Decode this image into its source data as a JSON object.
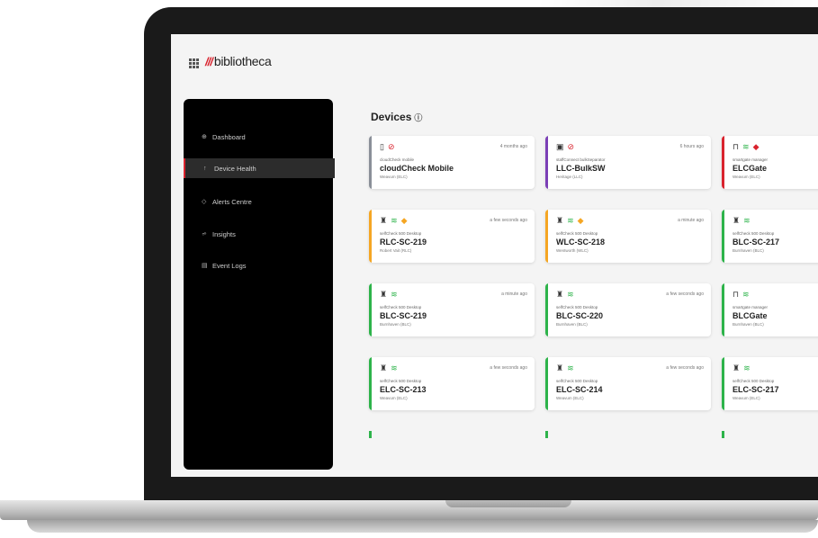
{
  "app": {
    "logo_mark": "///",
    "logo_text": "bibliotheca"
  },
  "sidebar": {
    "items": [
      {
        "label": "Dashboard",
        "icon": "dashboard-icon",
        "glyph": "⊕"
      },
      {
        "label": "Device Health",
        "icon": "heartbeat-icon",
        "glyph": "↑"
      },
      {
        "label": "Alerts Centre",
        "icon": "alert-icon",
        "glyph": "◇"
      },
      {
        "label": "Insights",
        "icon": "chart-icon",
        "glyph": "⩫"
      },
      {
        "label": "Event Logs",
        "icon": "document-icon",
        "glyph": "▤"
      }
    ]
  },
  "main": {
    "title": "Devices",
    "title_icon": "info-icon"
  },
  "colors": {
    "gray": "#8a8f98",
    "purple": "#7b3fb6",
    "red": "#d9232e",
    "orange": "#f5a623",
    "green": "#2db34a"
  },
  "cards": [
    {
      "type": "cloudCheck mobile",
      "name": "cloudCheck Mobile",
      "location": "Weavum (ELC)",
      "time": "4 months ago",
      "status_color": "#8a8f98",
      "device_icon": "phone-icon",
      "status_icons": [
        "no-signal-icon"
      ]
    },
    {
      "type": "staffConnect bulkSeparator",
      "name": "LLC-BulkSW",
      "location": "Heritage (LLC)",
      "time": "6 hours ago",
      "status_color": "#7b3fb6",
      "device_icon": "sorter-icon",
      "status_icons": [
        "no-signal-icon"
      ]
    },
    {
      "type": "smartgate manager",
      "name": "ELCGate",
      "location": "Weavum (ELC)",
      "time": "",
      "status_color": "#d9232e",
      "device_icon": "gate-icon",
      "status_icons": [
        "wifi-icon",
        "error-diamond-icon"
      ]
    },
    {
      "type": "selfCheck 500 Desktop",
      "name": "RLC-SC-219",
      "location": "Robert Vait (RLC)",
      "time": "a few seconds ago",
      "status_color": "#f5a623",
      "device_icon": "kiosk-icon",
      "status_icons": [
        "wifi-icon",
        "warning-diamond-icon"
      ]
    },
    {
      "type": "selfCheck 500 Desktop",
      "name": "WLC-SC-218",
      "location": "Wentworth (WLC)",
      "time": "a minute ago",
      "status_color": "#f5a623",
      "device_icon": "kiosk-icon",
      "status_icons": [
        "wifi-icon",
        "warning-diamond-icon"
      ]
    },
    {
      "type": "selfCheck 500 Desktop",
      "name": "BLC-SC-217",
      "location": "Burnhaven (BLC)",
      "time": "",
      "status_color": "#2db34a",
      "device_icon": "kiosk-icon",
      "status_icons": [
        "wifi-icon"
      ]
    },
    {
      "type": "selfCheck 500 Desktop",
      "name": "BLC-SC-219",
      "location": "Burnhaven (BLC)",
      "time": "a minute ago",
      "status_color": "#2db34a",
      "device_icon": "kiosk-icon",
      "status_icons": [
        "wifi-icon"
      ]
    },
    {
      "type": "selfCheck 500 Desktop",
      "name": "BLC-SC-220",
      "location": "Burnhaven (BLC)",
      "time": "a few seconds ago",
      "status_color": "#2db34a",
      "device_icon": "kiosk-icon",
      "status_icons": [
        "wifi-icon"
      ]
    },
    {
      "type": "smartgate manager",
      "name": "BLCGate",
      "location": "Burnhaven (BLC)",
      "time": "",
      "status_color": "#2db34a",
      "device_icon": "gate-icon",
      "status_icons": [
        "wifi-icon"
      ]
    },
    {
      "type": "selfCheck 500 Desktop",
      "name": "ELC-SC-213",
      "location": "Weavum (ELC)",
      "time": "a few seconds ago",
      "status_color": "#2db34a",
      "device_icon": "kiosk-icon",
      "status_icons": [
        "wifi-icon"
      ]
    },
    {
      "type": "selfCheck 500 Desktop",
      "name": "ELC-SC-214",
      "location": "Weavum (ELC)",
      "time": "a few seconds ago",
      "status_color": "#2db34a",
      "device_icon": "kiosk-icon",
      "status_icons": [
        "wifi-icon"
      ]
    },
    {
      "type": "selfCheck 500 Desktop",
      "name": "ELC-SC-217",
      "location": "Weavum (ELC)",
      "time": "",
      "status_color": "#2db34a",
      "device_icon": "kiosk-icon",
      "status_icons": [
        "wifi-icon"
      ]
    }
  ]
}
